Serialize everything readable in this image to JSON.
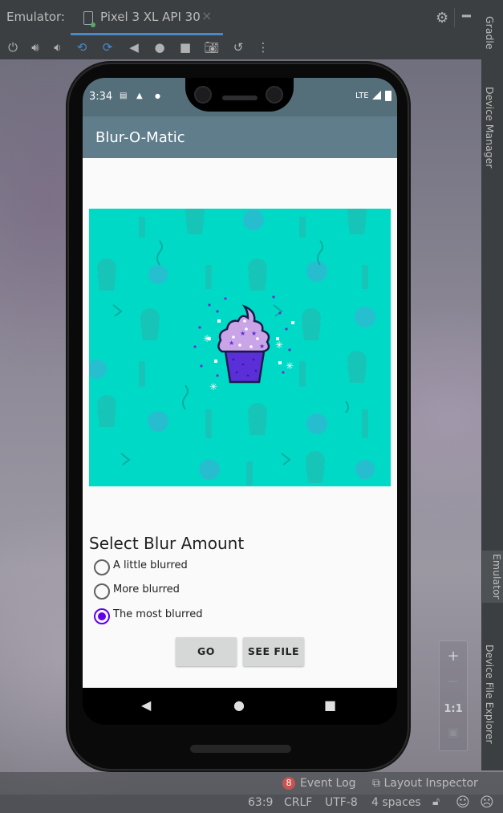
{
  "topbar": {
    "label": "Emulator:",
    "tab_name": "Pixel 3 XL API 30",
    "tab_close": "×"
  },
  "toolbar": {
    "icons": [
      "power-icon",
      "volume-up-icon",
      "volume-down-icon",
      "rotate-left-icon",
      "rotate-right-icon",
      "back-icon",
      "home-icon",
      "overview-icon",
      "camera-icon",
      "snapshot-icon",
      "more-icon"
    ]
  },
  "side_tabs": {
    "gradle": "Gradle",
    "device_manager": "Device Manager",
    "emulator": "Emulator",
    "device_file_explorer": "Device File Explorer"
  },
  "zoom": {
    "plus": "+",
    "minus": "−",
    "ratio": "1:1"
  },
  "bottom": {
    "event_log_count": "8",
    "event_log": "Event Log",
    "layout_inspector": "Layout Inspector",
    "position": "63:9",
    "line_sep": "CRLF",
    "encoding": "UTF-8",
    "indent": "4 spaces"
  },
  "phone": {
    "time": "3:34",
    "network": "LTE",
    "app_title": "Blur-O-Matic",
    "blur_heading": "Select Blur Amount",
    "options": [
      {
        "label": "A little blurred",
        "selected": false
      },
      {
        "label": "More blurred",
        "selected": false
      },
      {
        "label": "The most blurred",
        "selected": true
      }
    ],
    "go_button": "GO",
    "see_file_button": "SEE FILE"
  },
  "colors": {
    "status_bar": "#546e7a",
    "app_bar": "#607d8b",
    "accent": "#6200ee",
    "image_bg": "#00d9c6",
    "cupcake_top": "#c9a4e6",
    "cupcake_cup": "#5b2fd8"
  }
}
